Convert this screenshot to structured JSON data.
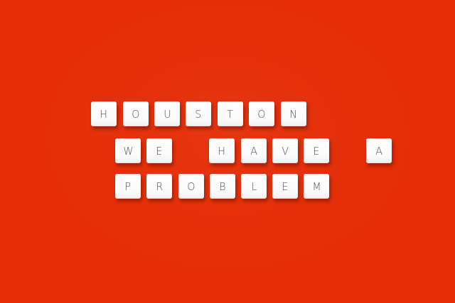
{
  "background_color": "#e42d06",
  "tile_color": "#ffffff",
  "letter_color": "#555555",
  "rows": [
    {
      "letters": [
        "H",
        "O",
        "U",
        "S",
        "T",
        "O",
        "N"
      ]
    },
    {
      "letters": [
        "W",
        "E",
        "H",
        "A",
        "V",
        "E",
        "A"
      ]
    },
    {
      "letters": [
        "P",
        "R",
        "O",
        "B",
        "L",
        "E",
        "M"
      ]
    }
  ]
}
